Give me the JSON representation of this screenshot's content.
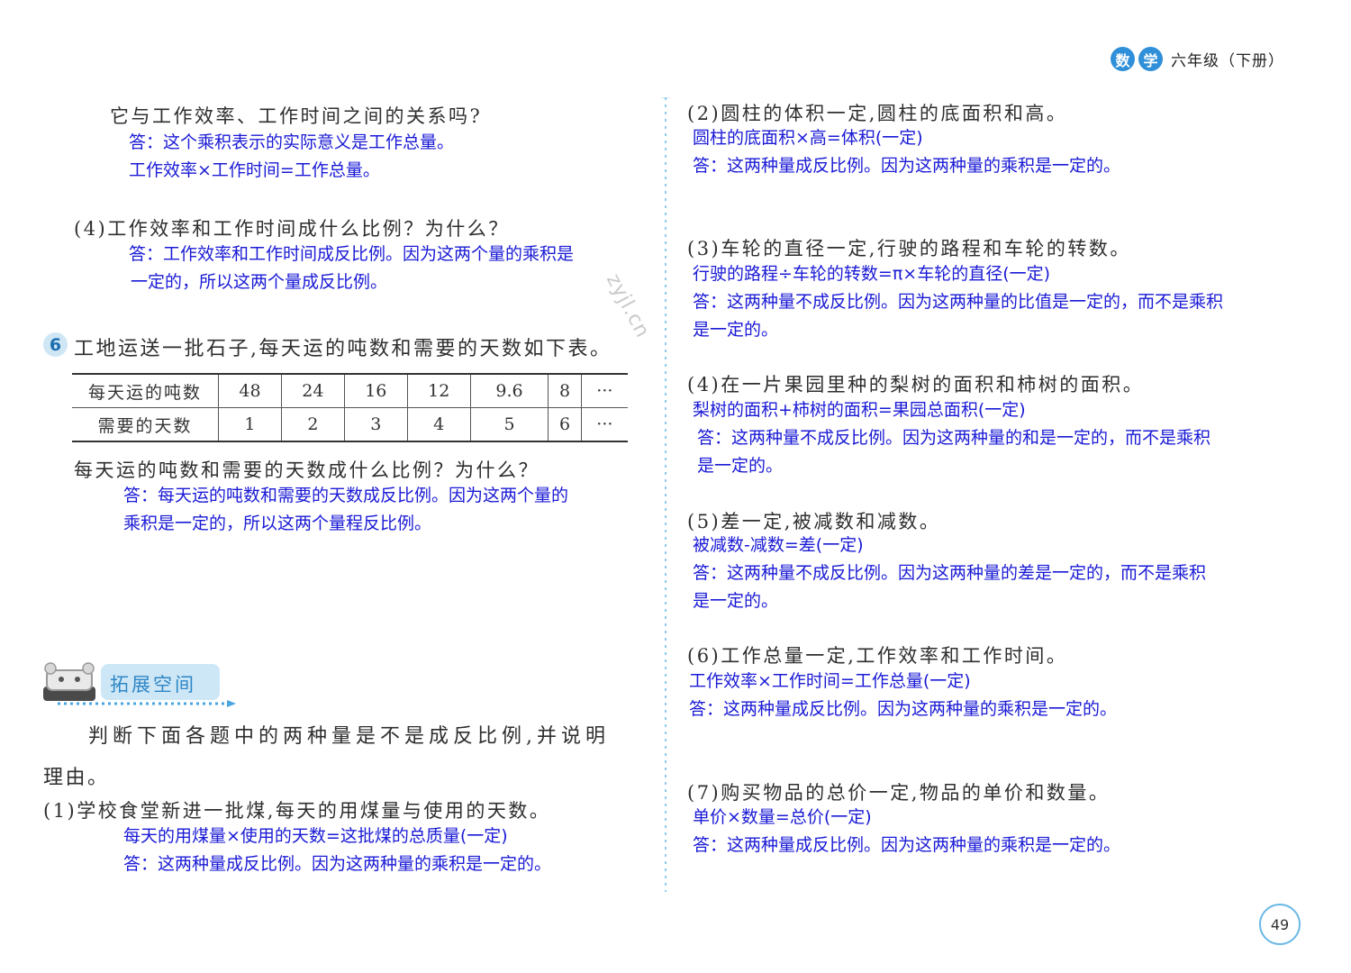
{
  "header": {
    "badge1": "数",
    "badge2": "学",
    "grade": "六年级（下册）"
  },
  "page_number": "49",
  "watermark": "zyjl.cn",
  "left": {
    "q3_continue": "它与工作效率、工作时间之间的关系吗?",
    "q3_ans1": "答：这个乘积表示的实际意义是工作总量。",
    "q3_ans2": "工作效率×工作时间=工作总量。",
    "q4_text": "(4)工作效率和工作时间成什么比例？为什么？",
    "q4_ans1": "答：工作效率和工作时间成反比例。因为这两个量的乘积是",
    "q4_ans2": "一定的，所以这两个量成反比例。",
    "p6_num": "6",
    "p6_text": "工地运送一批石子,每天运的吨数和需要的天数如下表。",
    "table": {
      "row1_label": "每天运的吨数",
      "row1": [
        "48",
        "24",
        "16",
        "12",
        "9.6",
        "8",
        "···"
      ],
      "row2_label": "需要的天数",
      "row2": [
        "1",
        "2",
        "3",
        "4",
        "5",
        "6",
        "···"
      ]
    },
    "p6_q": "每天运的吨数和需要的天数成什么比例？为什么？",
    "p6_ans1": "答：每天运的吨数和需要的天数成反比例。因为这两个量的",
    "p6_ans2": "乘积是一定的，所以这两个量程反比例。",
    "section_title": "拓展空间",
    "intro1": "判断下面各题中的两种量是不是成反比例,并说明",
    "intro2": "理由。",
    "i1_text": "(1)学校食堂新进一批煤,每天的用煤量与使用的天数。",
    "i1_eq": "每天的用煤量×使用的天数=这批煤的总质量(一定)",
    "i1_ans": "答：这两种量成反比例。因为这两种量的乘积是一定的。"
  },
  "right": {
    "i2_text": "(2)圆柱的体积一定,圆柱的底面积和高。",
    "i2_eq": "圆柱的底面积×高=体积(一定)",
    "i2_ans": "答：这两种量成反比例。因为这两种量的乘积是一定的。",
    "i3_text": "(3)车轮的直径一定,行驶的路程和车轮的转数。",
    "i3_eq": "行驶的路程÷车轮的转数=π×车轮的直径(一定)",
    "i3_ans1": "答：这两种量不成反比例。因为这两种量的比值是一定的，而不是乘积",
    "i3_ans2": "是一定的。",
    "i4_text": "(4)在一片果园里种的梨树的面积和柿树的面积。",
    "i4_eq": "梨树的面积+柿树的面积=果园总面积(一定)",
    "i4_ans1": "答：这两种量不成反比例。因为这两种量的和是一定的，而不是乘积",
    "i4_ans2": "是一定的。",
    "i5_text": "(5)差一定,被减数和减数。",
    "i5_eq": "被减数-减数=差(一定)",
    "i5_ans1": "答：这两种量不成反比例。因为这两种量的差是一定的，而不是乘积",
    "i5_ans2": "是一定的。",
    "i6_text": "(6)工作总量一定,工作效率和工作时间。",
    "i6_eq": "工作效率×工作时间=工作总量(一定)",
    "i6_ans": "答：这两种量成反比例。因为这两种量的乘积是一定的。",
    "i7_text": "(7)购买物品的总价一定,物品的单价和数量。",
    "i7_eq": "单价×数量=总价(一定)",
    "i7_ans": "答：这两种量成反比例。因为这两种量的乘积是一定的。"
  },
  "colors": {
    "answer": "#1a1ad6",
    "accent": "#2f8fd8",
    "section_bg": "#cde7f6"
  }
}
